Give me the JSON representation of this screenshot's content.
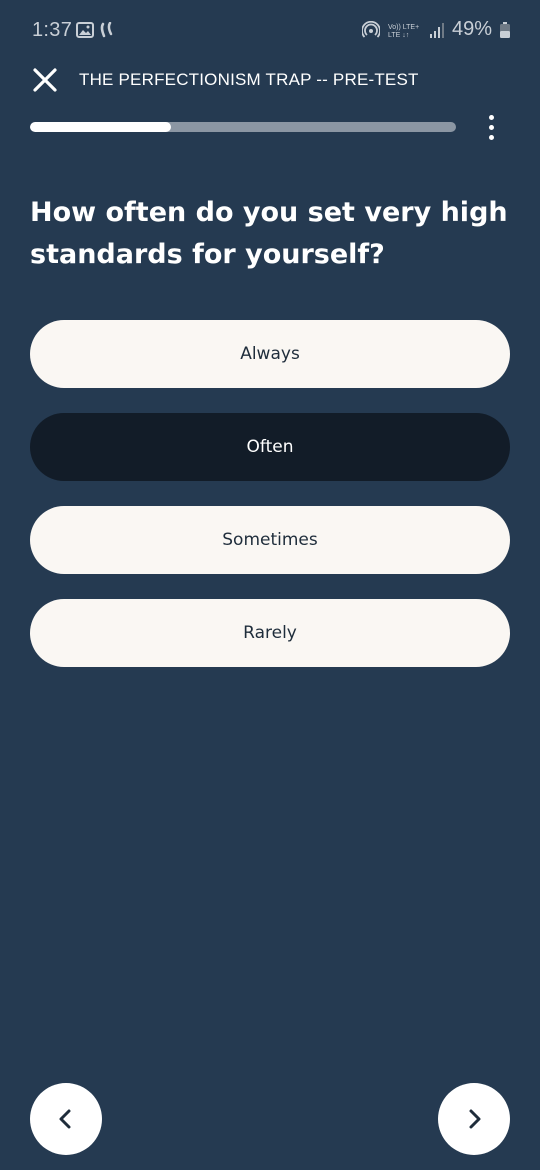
{
  "status_bar": {
    "time": "1:37",
    "battery": "49%",
    "icons": [
      "gallery-icon",
      "activity-icon",
      "hotspot-icon",
      "volte-icon",
      "signal-icon",
      "battery-icon"
    ]
  },
  "header": {
    "title": "THE PERFECTIONISM TRAP -- PRE-TEST",
    "close_icon": "close-icon",
    "more_icon": "more-vertical-icon"
  },
  "progress": {
    "fraction": 0.33
  },
  "question": {
    "text": "How often do you set very high standards for yourself?"
  },
  "options": [
    {
      "label": "Always",
      "selected": false
    },
    {
      "label": "Often",
      "selected": true
    },
    {
      "label": "Sometimes",
      "selected": false
    },
    {
      "label": "Rarely",
      "selected": false
    }
  ],
  "navigation": {
    "prev_icon": "chevron-left-icon",
    "next_icon": "chevron-right-icon"
  },
  "colors": {
    "background": "#253a51",
    "option_bg": "#faf7f3",
    "option_selected_bg": "#121c28",
    "progress_track": "#8b96a3",
    "progress_fill": "#ffffff"
  }
}
